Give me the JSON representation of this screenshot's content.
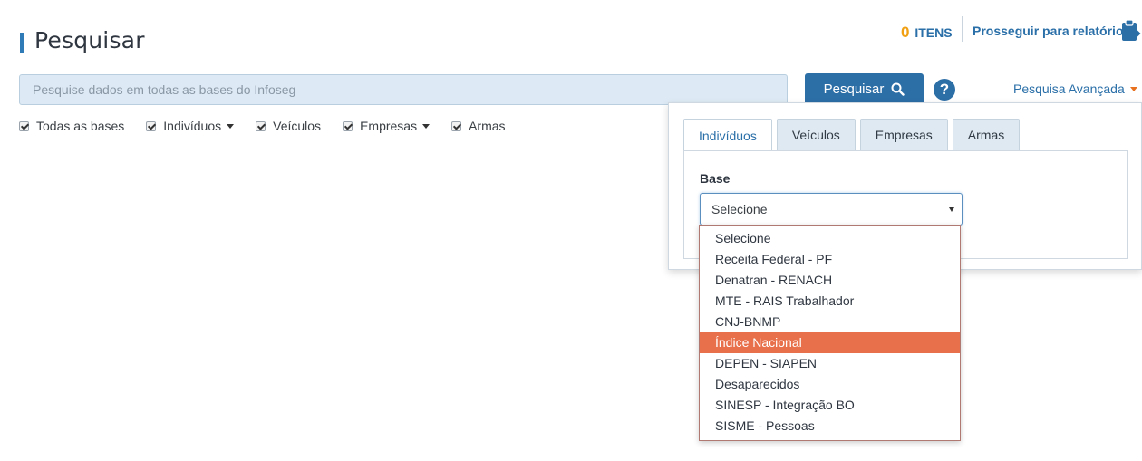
{
  "header": {
    "title": "Pesquisar",
    "items_count": "0",
    "items_label": "ITENS",
    "report_link": "Prosseguir para relatório",
    "report_icon": "clipboard-arrow-icon"
  },
  "search": {
    "placeholder": "Pesquise dados em todas as bases do Infoseg",
    "value": "",
    "button_label": "Pesquisar",
    "button_icon": "search-icon",
    "help_icon": "question-icon",
    "help_glyph": "?",
    "advanced_link": "Pesquisa Avançada"
  },
  "filters": [
    {
      "label": "Todas as bases",
      "checked": true,
      "has_menu": false
    },
    {
      "label": "Indivíduos",
      "checked": true,
      "has_menu": true
    },
    {
      "label": "Veículos",
      "checked": true,
      "has_menu": false
    },
    {
      "label": "Empresas",
      "checked": true,
      "has_menu": true
    },
    {
      "label": "Armas",
      "checked": true,
      "has_menu": false
    }
  ],
  "advanced": {
    "tabs": [
      "Indivíduos",
      "Veículos",
      "Empresas",
      "Armas"
    ],
    "active_tab": "Indivíduos",
    "base_label": "Base",
    "base_selected": "Selecione",
    "base_options": [
      "Selecione",
      "Receita Federal - PF",
      "Denatran - RENACH",
      "MTE - RAIS Trabalhador",
      "CNJ-BNMP",
      "Índice Nacional",
      "DEPEN - SIAPEN",
      "Desaparecidos",
      "SINESP - Integração BO",
      "SISME - Pessoas"
    ],
    "highlighted_option": "Índice Nacional"
  },
  "colors": {
    "accent": "#2c6ea6",
    "count": "#f0a012",
    "highlight": "#e8704a"
  }
}
